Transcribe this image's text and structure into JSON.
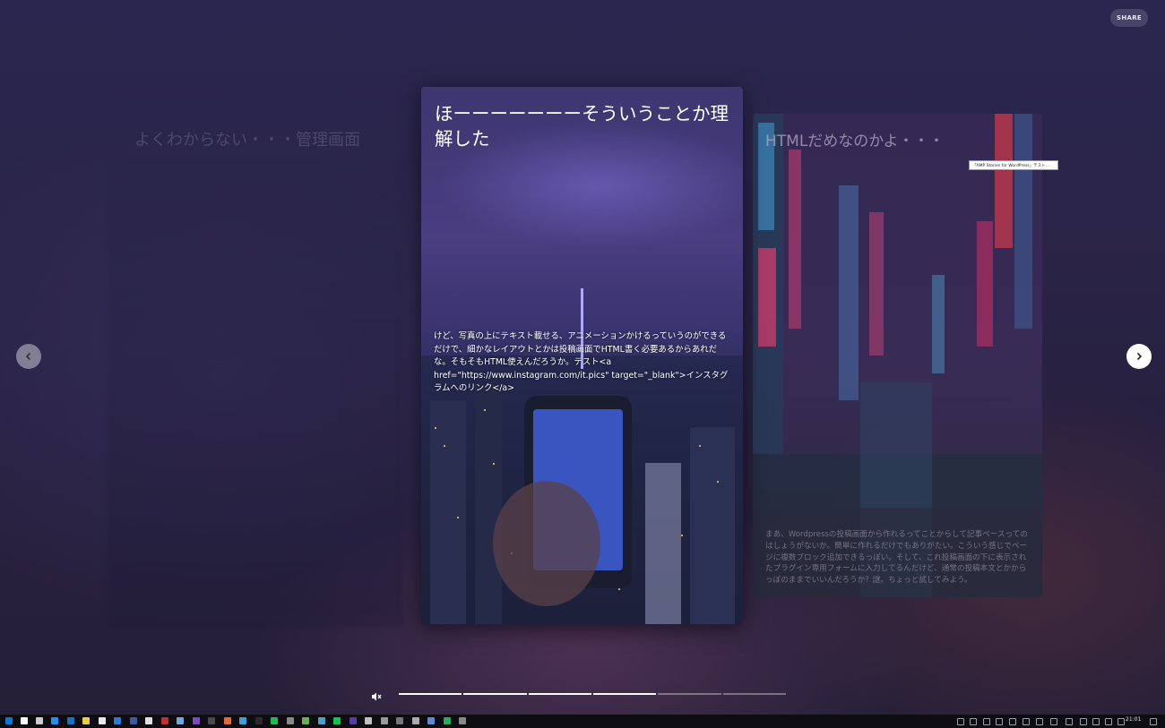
{
  "share": {
    "label": "SHARE"
  },
  "ghost_left": {
    "title": "よくわからない・・・管理画面"
  },
  "main_card": {
    "title": "ほーーーーーーーそういうことか理解した",
    "body": "けど、写真の上にテキスト載せる、アニメーションかけるっていうのができるだけで、細かなレイアウトとかは投稿画面でHTML書く必要あるからあれだな。そもそもHTML使えんだろうか。テスト<a href=\"https://www.instagram.com/it.pics\" target=\"_blank\">インスタグラムへのリンク</a>"
  },
  "side_card": {
    "title": "HTMLだめなのかよ・・・",
    "body": "まあ、Wordpressの投稿画面から作れるってことからして記事ベースってのはしょうがないか。簡単に作れるだけでもありがたい。こういう感じでページに複数ブロック追加できるっぽい。そして、これ投稿画面の下に表示されたプラグイン専用フォームに入力してるんだけど、通常の投稿本文とかからっぽのままでいいんだろうか？謎。ちょっと試してみよう。"
  },
  "tooltip": {
    "text": "「AMP Stories for WordPress」テスト..."
  },
  "navigation": {
    "prev_icon": "chevron-left-icon",
    "next_icon": "chevron-right-icon"
  },
  "progress": {
    "total_pages": 6,
    "current_page": 4
  },
  "taskbar": {
    "clock": "21:01"
  },
  "colors": {
    "bg": "#2a2448",
    "accent": "#ffffff"
  }
}
